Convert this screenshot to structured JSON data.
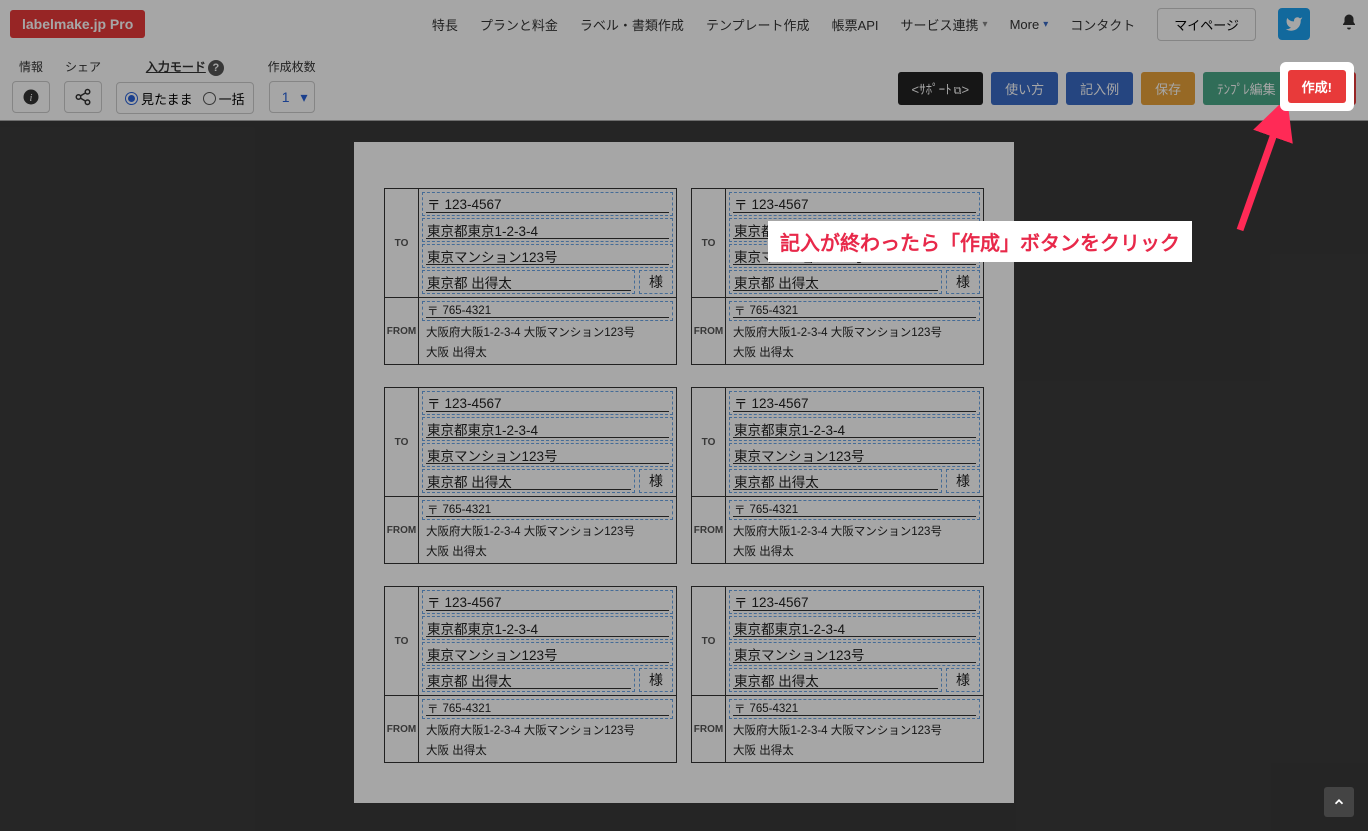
{
  "header": {
    "logo": "labelmake.jp Pro",
    "nav": [
      "特長",
      "プランと料金",
      "ラベル・書類作成",
      "テンプレート作成",
      "帳票API",
      "サービス連携",
      "More",
      "コンタクト"
    ],
    "mypage": "マイページ"
  },
  "toolbar": {
    "info_label": "情報",
    "share_label": "シェア",
    "mode_label": "入力モード",
    "count_label": "作成枚数",
    "mode_opt1": "見たまま",
    "mode_opt2": "一括",
    "count_value": "1",
    "btn_support": "<ｻﾎﾟｰﾄ",
    "btn_support_suffix": ">",
    "btn_usage": "使い方",
    "btn_example": "記入例",
    "btn_save": "保存",
    "btn_template": "ﾃﾝﾌﾟﾚ編集",
    "btn_create": "作成!"
  },
  "label": {
    "to": "TO",
    "from": "FROM",
    "postal_mark": "〒",
    "to_postal": "123-4567",
    "to_addr1": "東京都東京1-2-3-4",
    "to_addr2": "東京マンション123号",
    "to_name": "東京都 出得太",
    "sama": "様",
    "from_postal": "765-4321",
    "from_addr": "大阪府大阪1-2-3-4 大阪マンション123号",
    "from_name": "大阪 出得太"
  },
  "annotation": {
    "text": "記入が終わったら「作成」ボタンをクリック"
  }
}
